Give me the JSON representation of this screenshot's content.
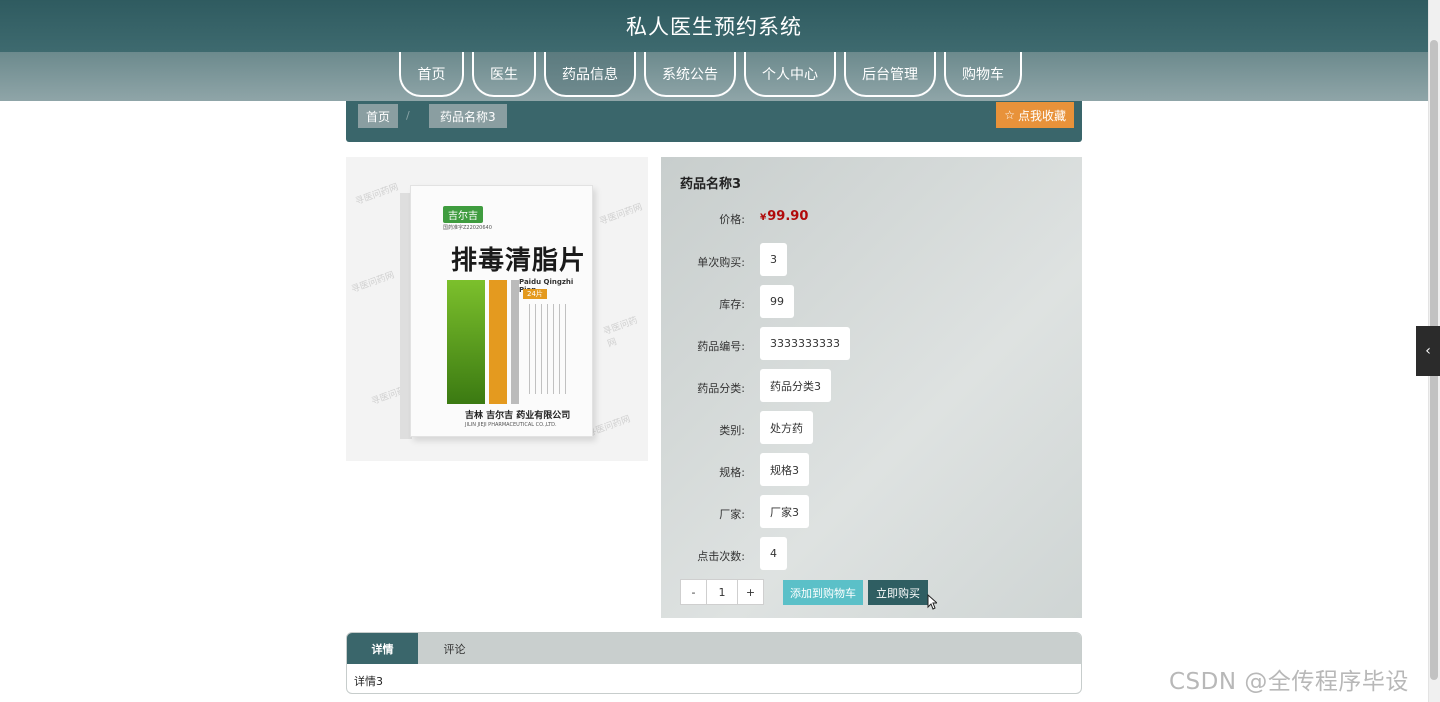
{
  "header": {
    "title": "私人医生预约系统"
  },
  "nav": {
    "items": [
      {
        "label": "首页",
        "active": false
      },
      {
        "label": "医生",
        "active": false
      },
      {
        "label": "药品信息",
        "active": true
      },
      {
        "label": "系统公告",
        "active": false
      },
      {
        "label": "个人中心",
        "active": false
      },
      {
        "label": "后台管理",
        "active": false
      },
      {
        "label": "购物车",
        "active": false
      }
    ]
  },
  "breadcrumb": {
    "home": "首页",
    "separator": "/",
    "current": "药品名称3"
  },
  "favorite_button": {
    "label": "点我收藏",
    "icon": "star-outline-icon"
  },
  "product_image": {
    "brand": "吉尔吉",
    "approval": "国药准字Z22020640",
    "name_cn": "排毒清脂片",
    "name_en": "Paidu Qingzhi Pian",
    "pack_count": "24片",
    "manufacturer": "吉林 吉尔吉 药业有限公司",
    "manufacturer_en": "JILIN JIEJI PHARMACEUTICAL CO.,LTD.",
    "watermark": "寻医问药网"
  },
  "product": {
    "title": "药品名称3",
    "price_label": "价格:",
    "currency": "¥",
    "price": "99.90",
    "fields": [
      {
        "label": "单次购买:",
        "value": "3"
      },
      {
        "label": "库存:",
        "value": "99"
      },
      {
        "label": "药品编号:",
        "value": "3333333333"
      },
      {
        "label": "药品分类:",
        "value": "药品分类3"
      },
      {
        "label": "类别:",
        "value": "处方药"
      },
      {
        "label": "规格:",
        "value": "规格3"
      },
      {
        "label": "厂家:",
        "value": "厂家3"
      },
      {
        "label": "点击次数:",
        "value": "4"
      }
    ],
    "quantity": {
      "minus": "-",
      "value": "1",
      "plus": "+"
    },
    "add_to_cart_label": "添加到购物车",
    "buy_now_label": "立即购买"
  },
  "tabs": {
    "items": [
      {
        "label": "详情",
        "active": true
      },
      {
        "label": "评论",
        "active": false
      }
    ],
    "content": "详情3"
  },
  "watermark": "CSDN @全传程序毕设",
  "colors": {
    "header_bg": "#3e6a6f",
    "accent_orange": "#e8923a",
    "cart_button": "#5bc0c8",
    "buy_button": "#2f5e62",
    "price_red": "#b10a0a"
  }
}
